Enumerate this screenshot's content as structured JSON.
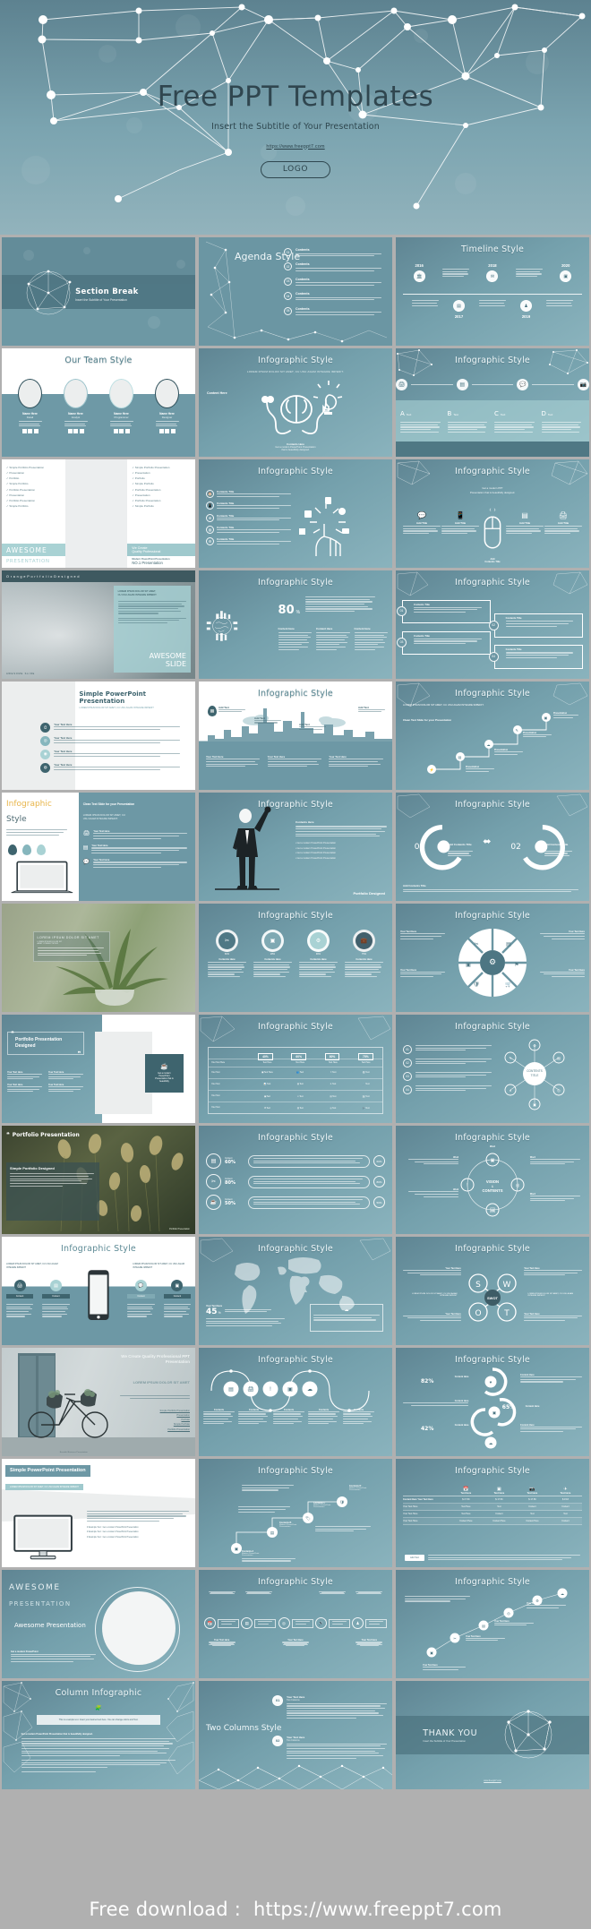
{
  "hero": {
    "title": "Free PPT Templates",
    "subtitle": "Insert the Subtitle of Your Presentation",
    "url": "https://www.freeppt7.com",
    "logo": "LOGO"
  },
  "footer": {
    "label": "Free download :",
    "url": "https://www.freeppt7.com"
  },
  "palette": {
    "teal_dark": "#4c727e",
    "teal_mid": "#6b97a4",
    "teal_light": "#8fb6c0",
    "mint": "#a9d2d4",
    "panel_light": "#f2f2f2",
    "accent_orange": "#e8b54a",
    "gray_bg": "#b0b0b0"
  },
  "slides": [
    {
      "n": 1,
      "name": "section-break",
      "title": "Section Break",
      "subtitle": "Insert the Subtitle of Your Presentation",
      "theme": "dark"
    },
    {
      "n": 2,
      "name": "agenda-style",
      "title": "Agenda Style",
      "items": [
        "Contents",
        "Contents",
        "Contents",
        "Contents",
        "Contents"
      ],
      "markers": [
        "01",
        "02",
        "03",
        "04",
        "05"
      ],
      "theme": "dark"
    },
    {
      "n": 3,
      "name": "timeline-style",
      "title": "Timeline Style",
      "years": [
        "2016",
        "2017",
        "2018",
        "2019",
        "2020"
      ],
      "theme": "dark"
    },
    {
      "n": 4,
      "name": "our-team-style",
      "title": "Our Team Style",
      "members": [
        "Name Here",
        "Name Here",
        "Name Here",
        "Name Here"
      ],
      "roles": [
        "Detail",
        "Analyst",
        "Programmer",
        "Designer"
      ],
      "theme": "light"
    },
    {
      "n": 5,
      "name": "infographic-brain",
      "title": "Infographic Style",
      "subtitle": "LOREM IPSUM DOLOR SIT AMET, CU USU AGAM INTEGRE IMPEDIT.",
      "label": "Content Here",
      "theme": "dark"
    },
    {
      "n": 6,
      "name": "infographic-abcd",
      "title": "Infographic Style",
      "cols": [
        "A",
        "B",
        "C",
        "D"
      ],
      "colsub": [
        "Text",
        "Text",
        "Text",
        "Text"
      ],
      "theme": "dark"
    },
    {
      "n": 7,
      "name": "awesome-presentation",
      "title": "AWESOME",
      "subtitle": "PRESENTATION",
      "side": [
        "We Create",
        "Quality Professional"
      ],
      "tag": "Modern PowerPoint Presentation",
      "tag2": "NO.1 Presentation",
      "theme": "light"
    },
    {
      "n": 8,
      "name": "infographic-hand",
      "title": "Infographic Style",
      "theme": "dark"
    },
    {
      "n": 9,
      "name": "infographic-mouse",
      "title": "Infographic Style",
      "theme": "dark"
    },
    {
      "n": 10,
      "name": "awesome-slide-photo",
      "title": "AWESOME",
      "subtitle": "SLIDE",
      "header": "O r a n g e   P o r t f o l i o   D e s i g n e d",
      "foot": "AWESOME SLIDE",
      "theme": "photo"
    },
    {
      "n": 11,
      "name": "infographic-globe",
      "title": "Infographic Style",
      "stat": "80",
      "statunit": "%",
      "cols": [
        "Content Here",
        "Content Here",
        "Content Here"
      ],
      "theme": "dark"
    },
    {
      "n": 12,
      "name": "infographic-cards",
      "title": "Infographic Style",
      "markers": [
        "01",
        "02",
        "03",
        "04"
      ],
      "theme": "dark"
    },
    {
      "n": 13,
      "name": "simple-powerpoint",
      "title": "Simple PowerPoint Presentation",
      "subtitle": "LOREM IPSUM DOLOR SIT AMET, CU USU AGAM INTEGRE IMPEDIT",
      "rows": [
        "Your Text Here",
        "Your Text Here",
        "Your Text Here",
        "Your Text Here"
      ],
      "theme": "light"
    },
    {
      "n": 14,
      "name": "infographic-city",
      "title": "Infographic Style",
      "pins": [
        "Add Text",
        "Add Text",
        "Add Text",
        "Add Text"
      ],
      "cols": [
        "Your Text Here",
        "Your Text Here",
        "Your Text Here"
      ],
      "theme": "split"
    },
    {
      "n": 15,
      "name": "infographic-steps",
      "title": "Infographic Style",
      "subtitle": "LOREM IPSUM DOLOR SIT AMET, CU USU AGAM INTEGRE IMPEDIT.",
      "label": "Clean Text Slide for your Presentation",
      "theme": "dark"
    },
    {
      "n": 16,
      "name": "infographic-laptop",
      "title": "Infographic",
      "subtitle": "Style",
      "theme": "light"
    },
    {
      "n": 17,
      "name": "infographic-man",
      "title": "Infographic Style",
      "foot": "Portfolio Designed",
      "theme": "dark"
    },
    {
      "n": 18,
      "name": "infographic-0102",
      "title": "Infographic Style",
      "markers": [
        "01",
        "02"
      ],
      "labels": [
        "Add Contents Title",
        "Add Contents Title"
      ],
      "theme": "dark"
    },
    {
      "n": 19,
      "name": "plant-photo",
      "title": "LOREM IPSUM DOLOR SIT AMET",
      "theme": "photo"
    },
    {
      "n": 20,
      "name": "infographic-donuts",
      "title": "Infographic Style",
      "values": [
        "60%",
        "28%",
        "90%",
        "75%"
      ],
      "theme": "dark"
    },
    {
      "n": 21,
      "name": "infographic-wheel",
      "title": "Infographic Style",
      "labels": [
        "Your Text Here",
        "Your Text Here",
        "Your Text Here",
        "Your Text Here"
      ],
      "theme": "dark"
    },
    {
      "n": 22,
      "name": "portfolio-presentation",
      "title": "Portfolio Presentation Designed",
      "theme": "dark"
    },
    {
      "n": 23,
      "name": "infographic-table",
      "title": "Infographic Style",
      "headers": [
        "40%",
        "60%",
        "80%",
        "75%"
      ],
      "theme": "dark"
    },
    {
      "n": 24,
      "name": "infographic-network",
      "title": "Infographic Style",
      "markers": [
        "01",
        "02",
        "03",
        "04"
      ],
      "center": "CONTENTS TITLE",
      "theme": "dark"
    },
    {
      "n": 25,
      "name": "portfolio-photo",
      "title": "Portfolio Presentation",
      "subtitle": "Simple Portfolio Designed",
      "foot": "Portfolio Presentation",
      "theme": "photo"
    },
    {
      "n": 26,
      "name": "infographic-bars",
      "title": "Infographic Style",
      "values": [
        "60%",
        "80%",
        "50%"
      ],
      "badges": [
        "60%",
        "80%",
        "50%"
      ],
      "theme": "dark"
    },
    {
      "n": 27,
      "name": "infographic-vision",
      "title": "Infographic Style",
      "center": "VISION & CONTENTS",
      "theme": "dark"
    },
    {
      "n": 28,
      "name": "infographic-phone",
      "title": "Infographic Style",
      "subL": "LOREM IPSUM DOLOR SIT AMET, CU USU AGAM INTEGRE IMPEDIT",
      "subR": "LOREM IPSUM DOLOR SIT AMET, CU USU AGAM INTEGRE IMPEDIT",
      "tabs": [
        "Content",
        "Content",
        "Content",
        "Content"
      ],
      "theme": "light"
    },
    {
      "n": 29,
      "name": "infographic-map",
      "title": "Infographic Style",
      "stat": "45",
      "statunit": "%",
      "label": "Your Text Here",
      "theme": "dark"
    },
    {
      "n": 30,
      "name": "infographic-swot",
      "title": "Infographic Style",
      "letters": [
        "S",
        "W",
        "O",
        "T"
      ],
      "center": "SWOT",
      "theme": "dark"
    },
    {
      "n": 31,
      "name": "door-bicycle-photo",
      "title": "We Create Quality Professional PPT Presentation",
      "subtitle": "LOREM IPSUM DOLOR SIT AMET",
      "theme": "photo"
    },
    {
      "n": 32,
      "name": "infographic-wave",
      "title": "Infographic Style",
      "cols": [
        "Contents",
        "Contents",
        "Contents",
        "Contents",
        "Contents"
      ],
      "theme": "dark"
    },
    {
      "n": 33,
      "name": "infographic-vertical",
      "title": "Infographic Style",
      "values": [
        "82%",
        "65%",
        "42%"
      ],
      "theme": "dark"
    },
    {
      "n": 34,
      "name": "simple-monitor",
      "title": "Simple PowerPoint Presentation",
      "subtitle": "LOREM IPSUM DOLOR SIT AMET, CU USU AGAM INTEGRE IMPEDIT",
      "theme": "light"
    },
    {
      "n": 35,
      "name": "infographic-flow",
      "title": "Infographic Style",
      "steps": [
        "Contents A",
        "Contents B",
        "Contents C",
        "Contents D"
      ],
      "theme": "dark"
    },
    {
      "n": 36,
      "name": "infographic-compare",
      "title": "Infographic Style",
      "cols": [
        "Text Here",
        "Text Here",
        "Text Here",
        "Text Here"
      ],
      "rows": [
        "Content Here Your Text Here",
        "Your Text Here",
        "Your Text Here",
        "Your Text Here"
      ],
      "button": "Add Text",
      "theme": "dark"
    },
    {
      "n": 37,
      "name": "awesome-circle",
      "title": "AWESOME",
      "subtitle": "PRESENTATION",
      "big": "Awesome Presentation",
      "theme": "dark"
    },
    {
      "n": 38,
      "name": "infographic-arrows",
      "title": "Infographic Style",
      "theme": "dark"
    },
    {
      "n": 39,
      "name": "infographic-scatter",
      "title": "Infographic Style",
      "theme": "dark"
    },
    {
      "n": 40,
      "name": "column-infographic",
      "title": "Column Infographic",
      "note": "This is a sample text. Insert your desired text here. You can change colors and Text.",
      "theme": "dark"
    },
    {
      "n": 41,
      "name": "two-columns-style",
      "title": "Two Columns Style",
      "markers": [
        "01",
        "02"
      ],
      "labels": [
        "Your Text Here",
        "Your Text Here"
      ],
      "subs": [
        "Two Columns",
        "Two Columns"
      ],
      "theme": "dark"
    },
    {
      "n": 42,
      "name": "thank-you",
      "title": "THANK YOU",
      "subtitle": "Insert the Subtitle of Your Presentation",
      "url": "www.freeppt7.com",
      "theme": "dark"
    }
  ]
}
